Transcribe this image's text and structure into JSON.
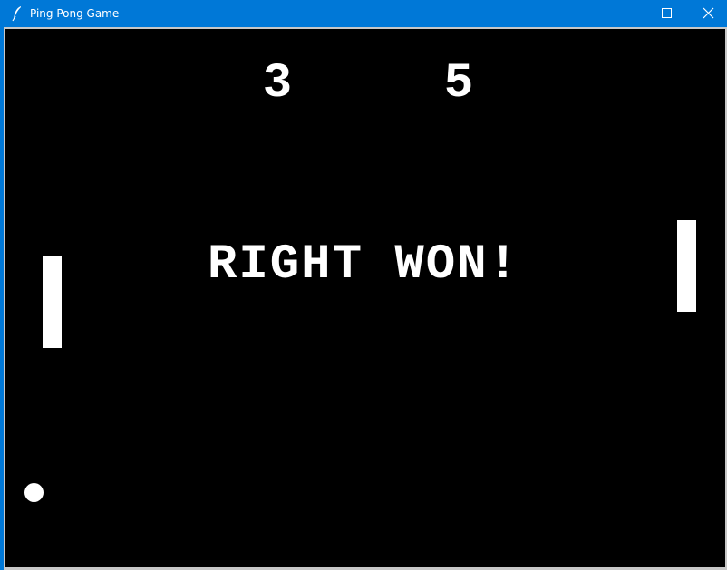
{
  "window": {
    "title": "Ping Pong Game",
    "icon": "feather-icon",
    "controls": {
      "minimize_icon": "minimize-icon",
      "maximize_icon": "maximize-icon",
      "close_icon": "close-icon"
    }
  },
  "game": {
    "score_left": "3",
    "score_right": "5",
    "message": "RIGHT WON!",
    "colors": {
      "background": "#000000",
      "foreground": "#ffffff",
      "titlebar": "#0078d7"
    }
  }
}
